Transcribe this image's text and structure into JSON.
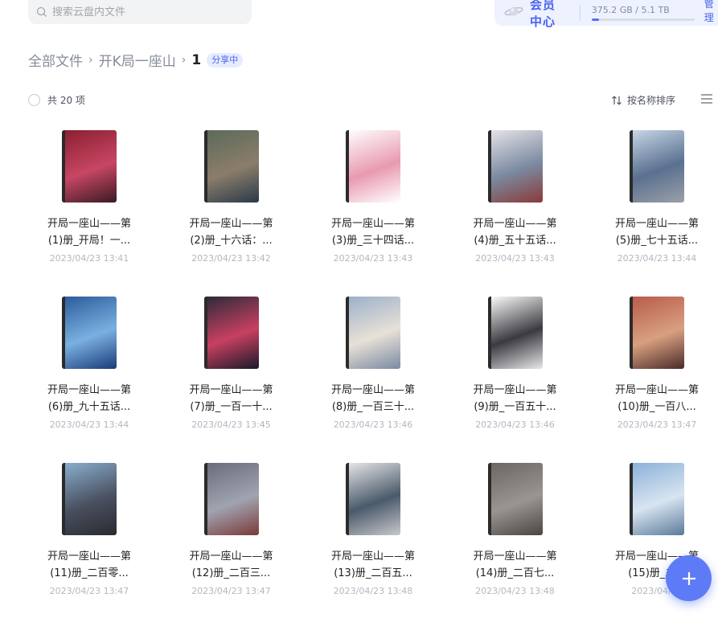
{
  "search": {
    "placeholder": "搜索云盘内文件"
  },
  "vip": {
    "label": "会员中心",
    "storage_text": "375.2 GB / 5.1 TB",
    "storage_fraction": 0.072,
    "manage_label": "管理"
  },
  "breadcrumb": {
    "items": [
      "全部文件",
      "开K局一座山"
    ],
    "current": "1",
    "badge": "分享中"
  },
  "toolbar": {
    "count": "共 20 项",
    "sort_label": "按名称排序"
  },
  "files": [
    {
      "line1": "开局一座山——第",
      "line2": "(1)册_开局！一...",
      "date": "2023/04/23 13:41",
      "colors": [
        "#8a1f2e",
        "#c74664",
        "#3a1a22"
      ]
    },
    {
      "line1": "开局一座山——第",
      "line2": "(2)册_十六话：...",
      "date": "2023/04/23 13:42",
      "colors": [
        "#5a6a5a",
        "#8b7d6a",
        "#2a3a4a"
      ]
    },
    {
      "line1": "开局一座山——第",
      "line2": "(3)册_三十四话...",
      "date": "2023/04/23 13:43",
      "colors": [
        "#ffffff",
        "#e89ab0",
        "#ffffff"
      ]
    },
    {
      "line1": "开局一座山——第",
      "line2": "(4)册_五十五话...",
      "date": "2023/04/23 13:43",
      "colors": [
        "#e8e4ea",
        "#7a8aa0",
        "#8a3a3a"
      ]
    },
    {
      "line1": "开局一座山——第",
      "line2": "(5)册_七十五话...",
      "date": "2023/04/23 13:44",
      "colors": [
        "#c8d8e8",
        "#5a7090",
        "#9aa0a8"
      ]
    },
    {
      "line1": "开局一座山——第",
      "line2": "(6)册_九十五话...",
      "date": "2023/04/23 13:44",
      "colors": [
        "#2a5a9a",
        "#7ab0e0",
        "#1a3a7a"
      ]
    },
    {
      "line1": "开局一座山——第",
      "line2": "(7)册_一百一十...",
      "date": "2023/04/23 13:45",
      "colors": [
        "#2a2a3a",
        "#c84060",
        "#1a1a2a"
      ]
    },
    {
      "line1": "开局一座山——第",
      "line2": "(8)册_一百三十...",
      "date": "2023/04/23 13:46",
      "colors": [
        "#9ab0c8",
        "#e8e0d8",
        "#7a8aa0"
      ]
    },
    {
      "line1": "开局一座山——第",
      "line2": "(9)册_一百五十...",
      "date": "2023/04/23 13:46",
      "colors": [
        "#ffffff",
        "#3a3a40",
        "#e8e8ea"
      ]
    },
    {
      "line1": "开局一座山——第",
      "line2": "(10)册_一百八...",
      "date": "2023/04/23 13:47",
      "colors": [
        "#b85a4a",
        "#d8a080",
        "#4a2a2a"
      ]
    },
    {
      "line1": "开局一座山——第",
      "line2": "(11)册_二百零...",
      "date": "2023/04/23 13:47",
      "colors": [
        "#8ab0d0",
        "#4a5060",
        "#2a2a30"
      ]
    },
    {
      "line1": "开局一座山——第",
      "line2": "(12)册_二百三...",
      "date": "2023/04/23 13:47",
      "colors": [
        "#6a6a78",
        "#a0a4b0",
        "#7a3a3a"
      ]
    },
    {
      "line1": "开局一座山——第",
      "line2": "(13)册_二百五...",
      "date": "2023/04/23 13:48",
      "colors": [
        "#e8e8ea",
        "#4a5a6a",
        "#c8c8cc"
      ]
    },
    {
      "line1": "开局一座山——第",
      "line2": "(14)册_二百七...",
      "date": "2023/04/23 13:48",
      "colors": [
        "#6a6560",
        "#9a9590",
        "#4a4540"
      ]
    },
    {
      "line1": "开局一座山——第",
      "line2": "(15)册_二...",
      "date": "2023/04/23",
      "colors": [
        "#8ab0d8",
        "#d8e4f0",
        "#5a7a9a"
      ]
    }
  ],
  "icons": {
    "search": "search-icon",
    "planet": "planet-icon",
    "sort": "sort-icon",
    "list_view": "list-view-icon",
    "add": "plus-icon"
  },
  "colors": {
    "accent": "#4a63f0",
    "fab": "#5e7bf7"
  }
}
